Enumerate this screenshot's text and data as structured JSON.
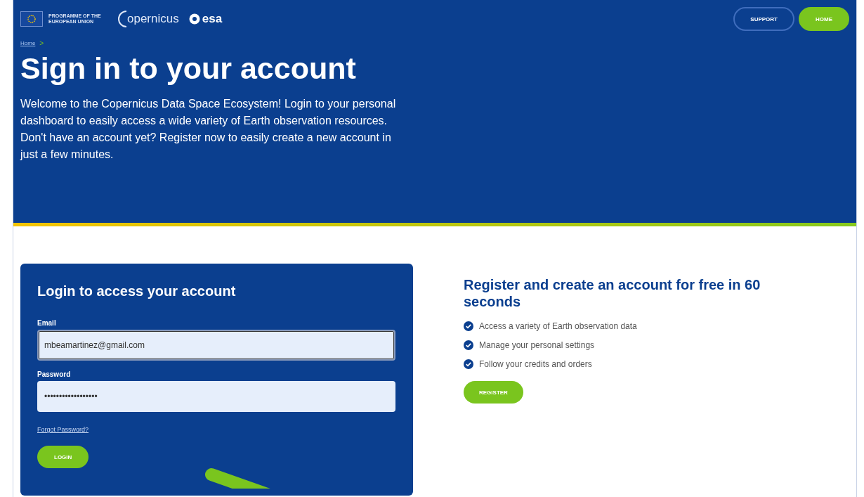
{
  "header": {
    "eu_logo_text": "PROGRAMME OF THE EUROPEAN UNION",
    "copernicus_logo_text": "opernicus",
    "esa_logo_text": "esa",
    "buttons": [
      {
        "label": "SUPPORT",
        "kind": "outline"
      },
      {
        "label": "HOME",
        "kind": "filled"
      }
    ]
  },
  "breadcrumb": {
    "items": [
      "Home"
    ],
    "separator": ">"
  },
  "hero": {
    "title": "Sign in to your account",
    "text": "Welcome to the Copernicus Data Space Ecosystem! Login to your personal dashboard to easily access a wide variety of Earth observation resources. Don't have an account yet? Register now to easily create a new account in just a few minutes."
  },
  "login": {
    "title": "Login to access your account",
    "fields": [
      {
        "label": "Email",
        "value": "mbeamartinez@gmail.com",
        "focused": true
      },
      {
        "label": "Password",
        "value": "••••••••••••••••••",
        "focused": false
      }
    ],
    "forgot_link": "Forgot Password?",
    "button": "LOGIN"
  },
  "register": {
    "title": "Register and create an account for free in 60 seconds",
    "features": [
      "Access a variety of Earth observation data",
      "Manage your personal settings",
      "Follow your credits and orders"
    ],
    "button": "REGISTER"
  }
}
